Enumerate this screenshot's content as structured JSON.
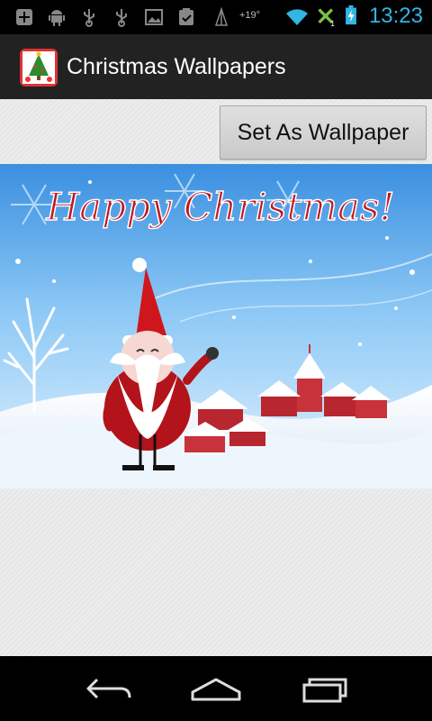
{
  "status_bar": {
    "time": "13:23",
    "temperature": "+19°",
    "icons": [
      "add-icon",
      "android-debug-icon",
      "usb-icon",
      "usb-icon",
      "image-icon",
      "checklist-icon",
      "antenna-icon",
      "wifi-icon",
      "no-signal-icon",
      "battery-charging-icon"
    ],
    "accent_color": "#33b5e5"
  },
  "action_bar": {
    "title": "Christmas Wallpapers",
    "icon": "christmas-tree-icon"
  },
  "main": {
    "set_wallpaper_label": "Set As Wallpaper",
    "wallpaper": {
      "greeting": "Happy Christmas!"
    }
  },
  "nav_bar": {
    "buttons": [
      "back-icon",
      "home-icon",
      "recent-apps-icon"
    ]
  }
}
